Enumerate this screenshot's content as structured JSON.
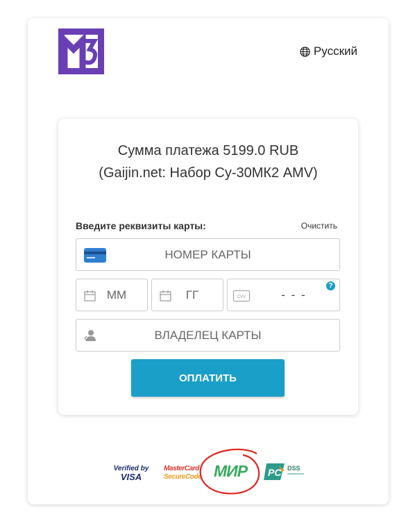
{
  "header": {
    "logo_alt": "M3",
    "language": "Русский",
    "globe_icon": "globe-icon"
  },
  "payment": {
    "amount_line": "Сумма платежа 5199.0 RUB",
    "description_line": "(Gaijin.net: Набор Су-30МК2 AMV)",
    "card_label": "Введите реквизиты карты:",
    "clear_label": "Очистить",
    "card_number_placeholder": "НОМЕР КАРТЫ",
    "month_placeholder": "ММ",
    "year_placeholder": "ГГ",
    "cvv_placeholder": "- - -",
    "cvv_badge": "CVV",
    "help_symbol": "?",
    "holder_placeholder": "ВЛАДЕЛЕЦ КАРТЫ",
    "pay_button": "ОПЛАТИТЬ"
  },
  "footer_logos": {
    "visa_line1": "Verified by",
    "visa_line2": "VISA",
    "mc_line1": "MasterCard",
    "mc_line2": "SecureCode",
    "mir": "МИР",
    "pci": "PCI",
    "dss": "DSS"
  },
  "colors": {
    "accent": "#1a9fc8",
    "logo_purple": "#6a3fb5",
    "mir_green": "#3aa85f",
    "annotation_red": "#e0231c"
  }
}
